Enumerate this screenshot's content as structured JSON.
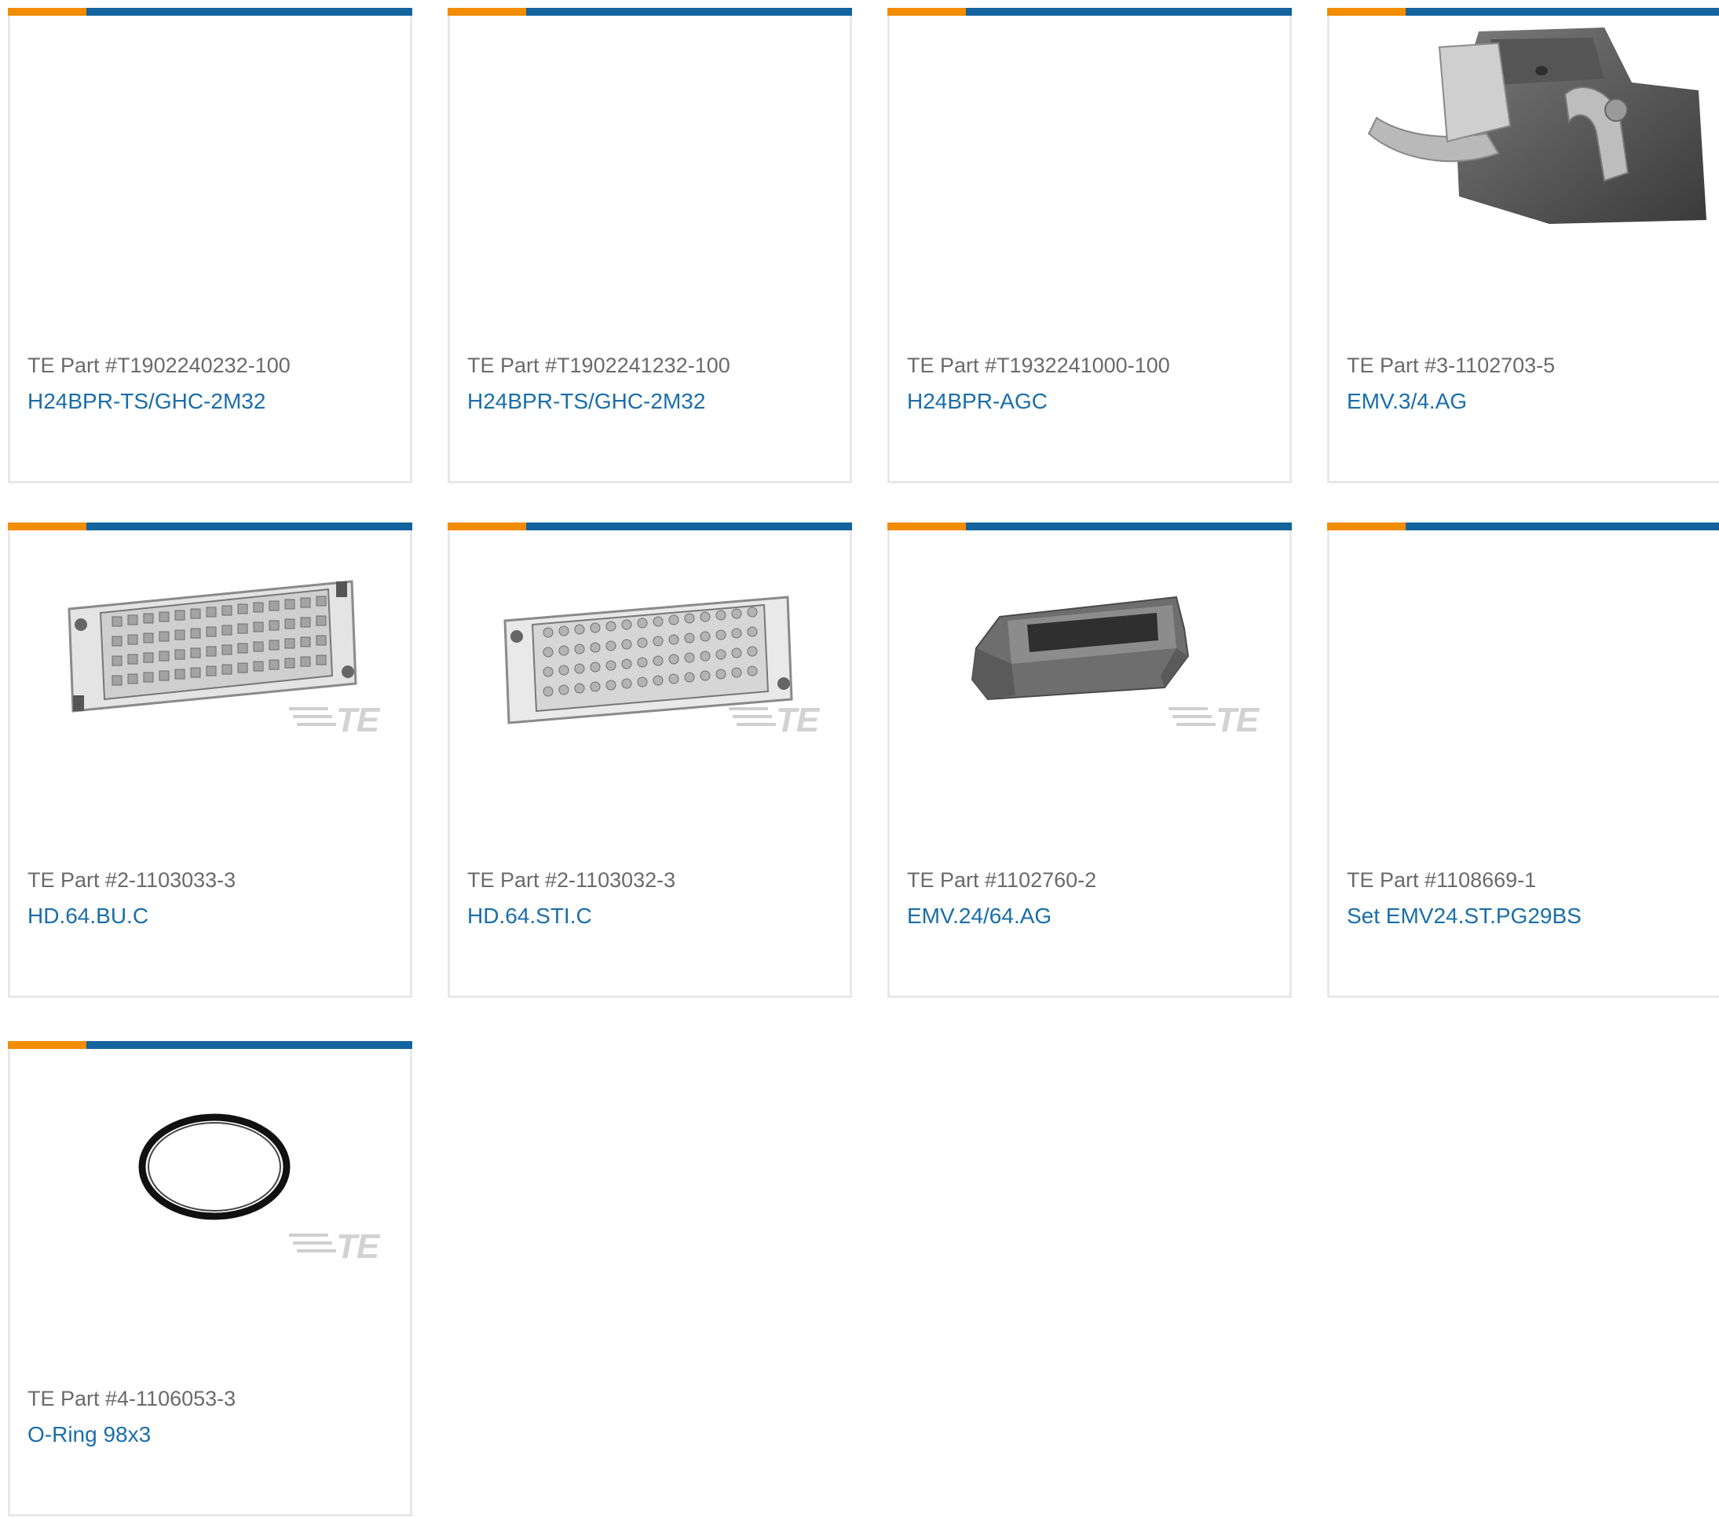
{
  "products": [
    {
      "part_label": "TE Part #T1902240232-100",
      "name": "H24BPR-TS/GHC-2M32",
      "image": "none"
    },
    {
      "part_label": "TE Part #T1902241232-100",
      "name": "H24BPR-TS/GHC-2M32",
      "image": "none"
    },
    {
      "part_label": "TE Part #T1932241000-100",
      "name": "H24BPR-AGC",
      "image": "none"
    },
    {
      "part_label": "TE Part #3-1102703-5",
      "name": "EMV.3/4.AG",
      "image": "hood-housing-icon"
    },
    {
      "part_label": "TE Part #2-1103033-3",
      "name": "HD.64.BU.C",
      "image": "connector-insert-icon",
      "watermark": "TE"
    },
    {
      "part_label": "TE Part #2-1103032-3",
      "name": "HD.64.STI.C",
      "image": "connector-insert-icon",
      "watermark": "TE"
    },
    {
      "part_label": "TE Part #1102760-2",
      "name": "EMV.24/64.AG",
      "image": "housing-frame-icon",
      "watermark": "TE"
    },
    {
      "part_label": "TE Part #1108669-1",
      "name": "Set EMV24.ST.PG29BS",
      "image": "none"
    },
    {
      "part_label": "TE Part #4-1106053-3",
      "name": "O-Ring 98x3",
      "image": "o-ring-icon",
      "watermark": "TE"
    }
  ],
  "colors": {
    "accent_orange": "#f28c00",
    "accent_blue": "#13639e",
    "link_blue": "#1a6ea8",
    "part_gray": "#6a6a6a",
    "border": "#e8e8e8"
  }
}
